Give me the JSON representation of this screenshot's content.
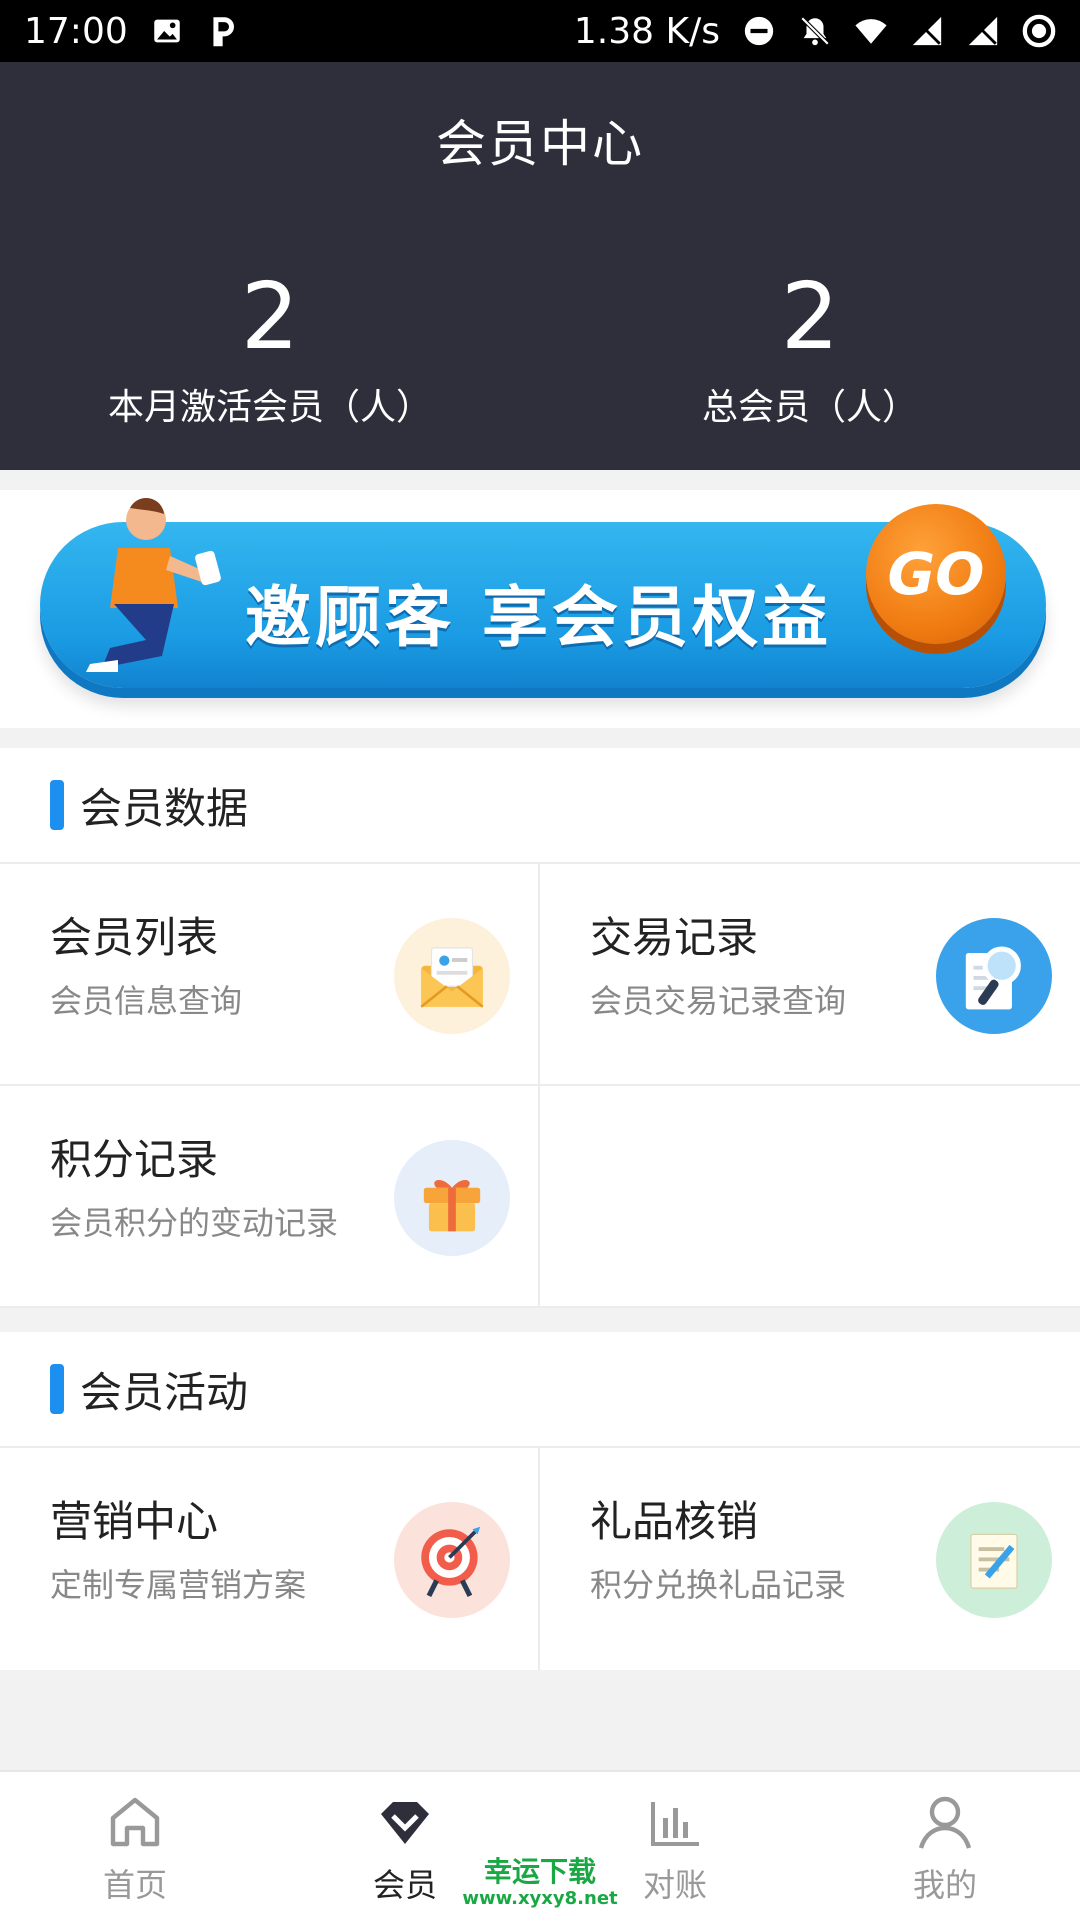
{
  "status_bar": {
    "time": "17:00",
    "speed": "1.38 K/s",
    "left_icons": [
      "image-icon",
      "p-app-icon"
    ],
    "right_icons": [
      "dnd-icon",
      "bell-off-icon",
      "wifi-icon",
      "no-sim-icon",
      "no-sim-icon",
      "battery-icon"
    ]
  },
  "header": {
    "title": "会员中心",
    "stats": [
      {
        "value": "2",
        "label": "本月激活会员（人）"
      },
      {
        "value": "2",
        "label": "总会员（人）"
      }
    ]
  },
  "banner": {
    "text": "邀顾客 享会员权益",
    "button": "GO"
  },
  "sections": [
    {
      "title": "会员数据",
      "items": [
        {
          "title": "会员列表",
          "subtitle": "会员信息查询",
          "icon": "envelope-icon",
          "icon_bg": "#fdf1dc"
        },
        {
          "title": "交易记录",
          "subtitle": "会员交易记录查询",
          "icon": "magnifier-document-icon",
          "icon_bg": "#3aa2ea"
        },
        {
          "title": "积分记录",
          "subtitle": "会员积分的变动记录",
          "icon": "gift-box-icon",
          "icon_bg": "#e6eefa"
        }
      ]
    },
    {
      "title": "会员活动",
      "items": [
        {
          "title": "营销中心",
          "subtitle": "定制专属营销方案",
          "icon": "target-icon",
          "icon_bg": "#fbe3dc"
        },
        {
          "title": "礼品核销",
          "subtitle": "积分兑换礼品记录",
          "icon": "document-pen-icon",
          "icon_bg": "#cdeed9"
        }
      ]
    }
  ],
  "bottom_nav": [
    {
      "label": "首页",
      "icon": "home-icon",
      "active": false
    },
    {
      "label": "会员",
      "icon": "diamond-icon",
      "active": true
    },
    {
      "label": "对账",
      "icon": "bar-chart-icon",
      "active": false
    },
    {
      "label": "我的",
      "icon": "user-icon",
      "active": false
    }
  ],
  "watermark": {
    "name": "幸运下载",
    "url": "www.xyxy8.net"
  },
  "colors": {
    "header_bg": "#2e2f3b",
    "accent": "#1c8ff0",
    "banner": "#1a9be3",
    "go": "#f07c12"
  }
}
